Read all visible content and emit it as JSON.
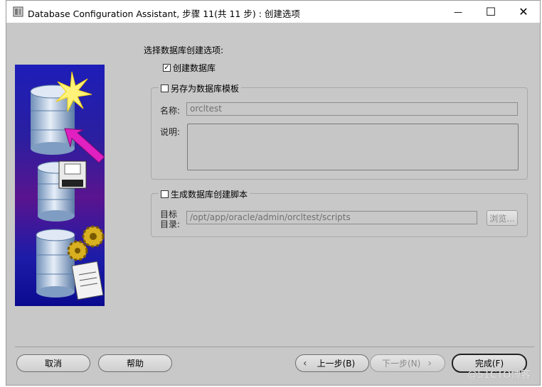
{
  "window": {
    "title": "Database Configuration Assistant, 步骤 11(共 11 步) : 创建选项",
    "minimize_glyph": "—",
    "maximize_glyph": "☐",
    "close_glyph": "✕"
  },
  "main": {
    "section_label": "选择数据库创建选项:",
    "create_db": {
      "label": "创建数据库",
      "checked": "✓"
    },
    "template_group": {
      "checkbox_label": "另存为数据库模板",
      "name_label": "名称:",
      "name_value": "orcltest",
      "desc_label": "说明:"
    },
    "script_group": {
      "checkbox_label": "生成数据库创建脚本",
      "dir_label_line1": "目标",
      "dir_label_line2": "目录:",
      "dir_value": "/opt/app/oracle/admin/orcltest/scripts",
      "browse_label": "浏览..."
    }
  },
  "footer": {
    "cancel": "取消",
    "help": "帮助",
    "back": "上一步(B)",
    "next": "下一步(N)",
    "finish": "完成(F)"
  },
  "watermark": "@51CTO博客",
  "colors": {
    "window_bg": "#c8c8c8",
    "banner_top": "#1d1db8",
    "arrow": "#e020c0"
  }
}
